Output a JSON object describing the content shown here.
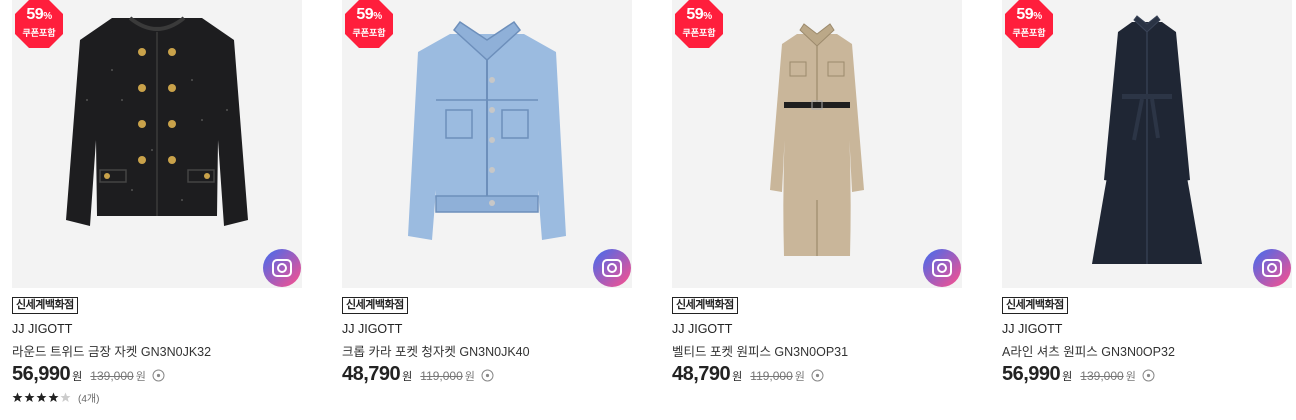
{
  "badge": {
    "percent": "59",
    "percent_sign": "%",
    "coupon": "쿠폰포함"
  },
  "currency": "원",
  "products": [
    {
      "store": "신세계백화점",
      "brand": "JJ JIGOTT",
      "name": "라운드 트위드 금장 자켓 GN3N0JK32",
      "price": "56,990",
      "original": "139,000",
      "rating": {
        "stars": 4.5,
        "count": "(4개)"
      }
    },
    {
      "store": "신세계백화점",
      "brand": "JJ JIGOTT",
      "name": "크롭 카라 포켓 청자켓 GN3N0JK40",
      "price": "48,790",
      "original": "119,000"
    },
    {
      "store": "신세계백화점",
      "brand": "JJ JIGOTT",
      "name": "벨티드 포켓 원피스 GN3N0OP31",
      "price": "48,790",
      "original": "119,000"
    },
    {
      "store": "신세계백화점",
      "brand": "JJ JIGOTT",
      "name": "A라인 셔츠 원피스 GN3N0OP32",
      "price": "56,990",
      "original": "139,000"
    }
  ],
  "icons": {
    "badge": "discount-badge-icon",
    "camera": "camera-search-icon",
    "info": "info-circle-icon",
    "star": "star-icon"
  },
  "colors": {
    "badge": "#ff1e3c",
    "camera_start": "#3f6cf0",
    "camera_end": "#ff4f8b",
    "background": "#f3f3f3"
  }
}
